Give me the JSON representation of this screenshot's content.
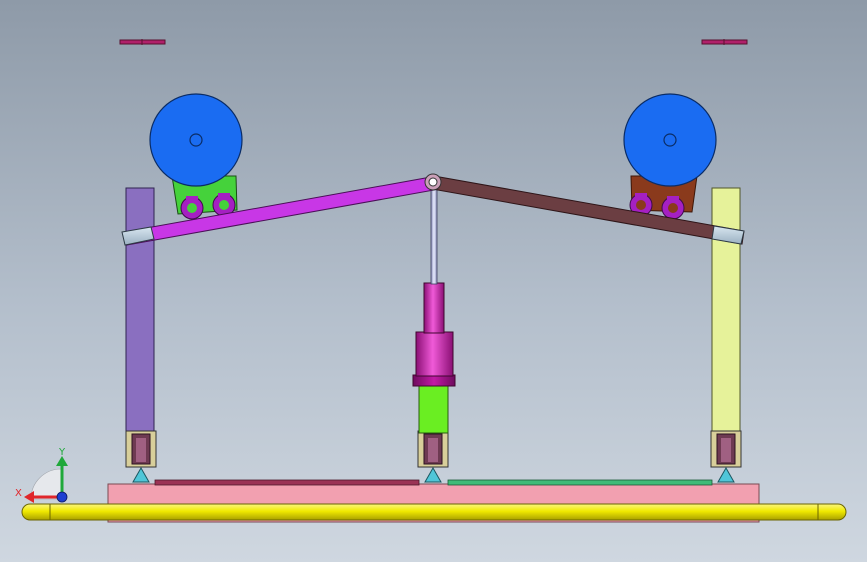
{
  "viewport": {
    "background_top": "#8e9aa8",
    "background_bottom": "#cfd7e0"
  },
  "triad": {
    "x_label": "X",
    "y_label": "Y",
    "x_color": "#e0262b",
    "y_color": "#1fa83a",
    "z_color": "#1e3fd1"
  },
  "parts": {
    "left_post_color": "#8a6fc0",
    "right_post_color": "#e6f29a",
    "left_arm_color": "#c837e6",
    "right_arm_color": "#6b3e42",
    "wheel_color": "#1a6cf2",
    "left_wheel_bracket_color": "#45d23b",
    "right_wheel_bracket_color": "#8a3a1c",
    "cylinder_color": "#d81fb8",
    "cylinder_base_color": "#6aee22",
    "base_plate_color": "#f2a0b0",
    "rail_color": "#f0ea00",
    "strip_left_color": "#9b3355",
    "strip_right_color": "#3fbb78"
  }
}
